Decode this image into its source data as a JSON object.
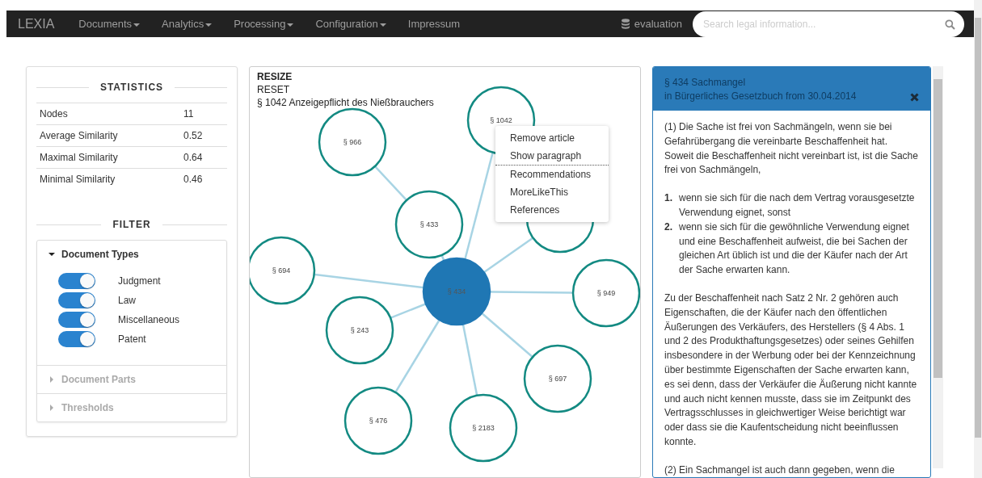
{
  "navbar": {
    "brand": "LEXIA",
    "menu": [
      {
        "label": "Documents",
        "dropdown": true
      },
      {
        "label": "Analytics",
        "dropdown": true
      },
      {
        "label": "Processing",
        "dropdown": true
      },
      {
        "label": "Configuration",
        "dropdown": true
      },
      {
        "label": "Impressum",
        "dropdown": false
      }
    ],
    "database": "evaluation",
    "search": {
      "placeholder": "Search legal information..."
    }
  },
  "statistics": {
    "title": "STATISTICS",
    "rows": [
      {
        "label": "Nodes",
        "value": "11"
      },
      {
        "label": "Average Similarity",
        "value": "0.52"
      },
      {
        "label": "Maximal Similarity",
        "value": "0.64"
      },
      {
        "label": "Minimal Similarity",
        "value": "0.46"
      }
    ]
  },
  "filter": {
    "title": "FILTER",
    "sections": [
      {
        "title": "Document Types",
        "expanded": true,
        "toggles": [
          {
            "label": "Judgment",
            "on": true
          },
          {
            "label": "Law",
            "on": true
          },
          {
            "label": "Miscellaneous",
            "on": true
          },
          {
            "label": "Patent",
            "on": true
          }
        ]
      },
      {
        "title": "Document Parts",
        "expanded": false
      },
      {
        "title": "Thresholds",
        "expanded": false
      }
    ]
  },
  "graph": {
    "actions": [
      "RESIZE",
      "RESET"
    ],
    "caption": "§ 1042 Anzeigepflicht des Nießbrauchers",
    "nodes": [
      {
        "label": "§ 1042",
        "selected": false
      },
      {
        "label": "§ 966",
        "selected": false
      },
      {
        "label": "§ 433",
        "selected": false
      },
      {
        "label": "§ 694",
        "selected": false
      },
      {
        "label": "§ 434",
        "selected": true
      },
      {
        "label": "§ 949",
        "selected": false
      },
      {
        "label": "§ 243",
        "selected": false
      },
      {
        "label": "§ 697",
        "selected": false
      },
      {
        "label": "§ 476",
        "selected": false
      },
      {
        "label": "§ 2183",
        "selected": false
      },
      {
        "selected": false
      }
    ],
    "context_menu": [
      [
        "Remove article",
        "Show paragraph"
      ],
      [
        "Recommendations",
        "MoreLikeThis",
        "References"
      ]
    ]
  },
  "document": {
    "title": "§ 434 Sachmangel",
    "subtitle": "in Bürgerliches Gesetzbuch from 30.04.2014",
    "paragraphs": [
      {
        "kind": "text",
        "text": "(1) Die Sache ist frei von Sachmängeln, wenn sie bei Gefahrübergang die vereinbarte Beschaffenheit hat. Soweit die Beschaffenheit nicht vereinbart ist, ist die Sache frei von Sachmängeln,"
      },
      {
        "kind": "list",
        "items": [
          {
            "number": "1.",
            "text": "wenn sie sich für die nach dem Vertrag vorausgesetzte Verwendung eignet, sonst"
          },
          {
            "number": "2.",
            "text": "wenn sie sich für die gewöhnliche Verwendung eignet und eine Beschaffenheit aufweist, die bei Sachen der gleichen Art üblich ist und die der Käufer nach der Art der Sache erwarten kann."
          }
        ]
      },
      {
        "kind": "text",
        "text": "Zu der Beschaffenheit nach Satz 2 Nr. 2 gehören auch Eigenschaften, die der Käufer nach den öffentlichen Äußerungen des Verkäufers, des Herstellers (§ 4 Abs. 1 und 2 des Produkthaftungsgesetzes) oder seines Gehilfen insbesondere in der Werbung oder bei der Kennzeichnung über bestimmte Eigenschaften der Sache erwarten kann, es sei denn, dass der Verkäufer die Äußerung nicht kannte und auch nicht kennen musste, dass sie im Zeitpunkt des Vertragsschlusses in gleichwertiger Weise berichtigt war oder dass sie die Kaufentscheidung nicht beeinflussen konnte."
      },
      {
        "kind": "text",
        "text": "(2) Ein Sachmangel ist auch dann gegeben, wenn die"
      }
    ]
  }
}
